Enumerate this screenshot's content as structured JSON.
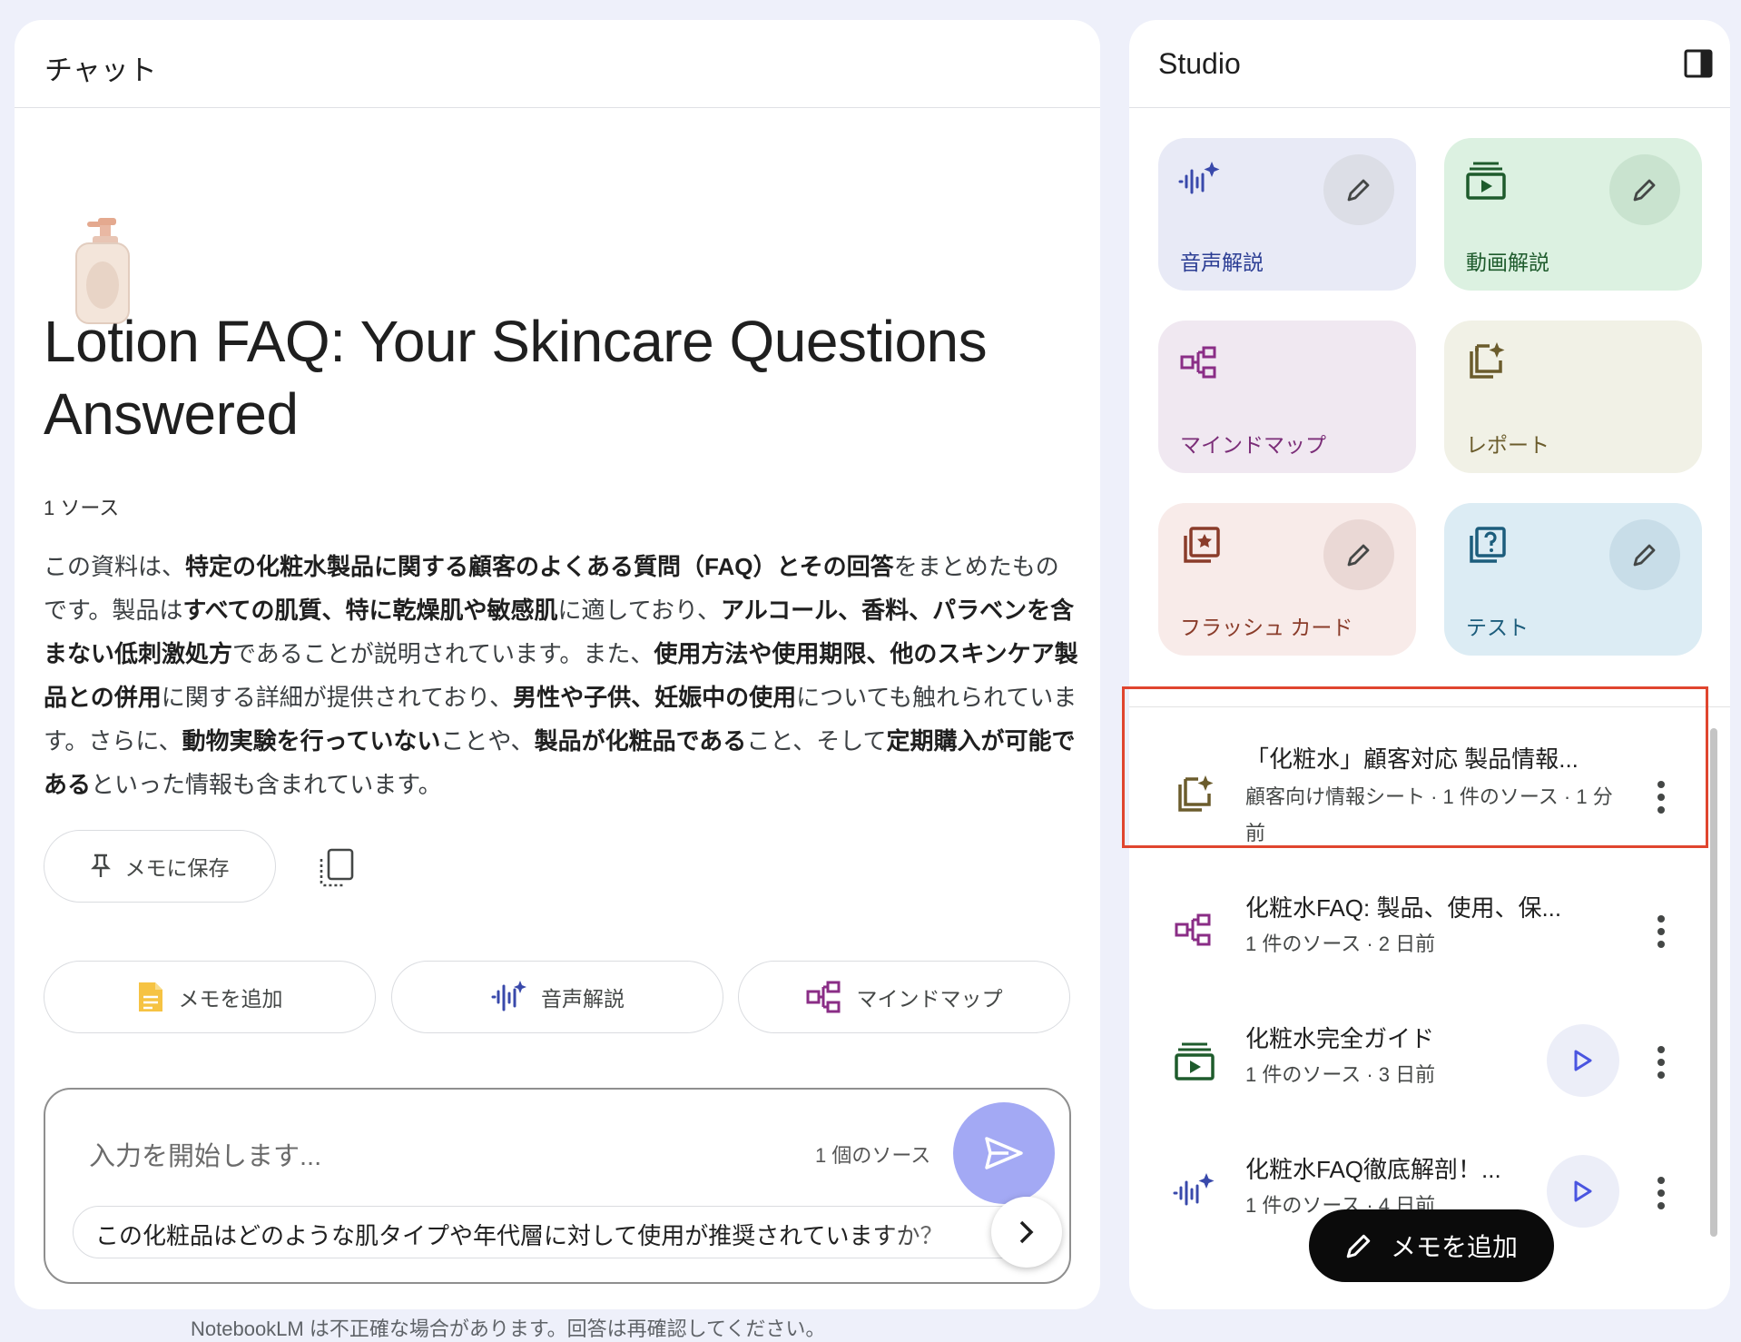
{
  "chat": {
    "title": "チャット",
    "doc_title": "Lotion FAQ: Your Skincare Questions Answered",
    "emoji_icon": "lotion-bottle-icon",
    "source_count": "1 ソース",
    "summary": [
      {
        "t": "この資料は、",
        "b": false
      },
      {
        "t": "特定の化粧水製品に関する顧客のよくある質問（FAQ）とその回答",
        "b": true
      },
      {
        "t": "をまとめたものです。製品は",
        "b": false
      },
      {
        "t": "すべての肌質、特に乾燥肌や敏感肌",
        "b": true
      },
      {
        "t": "に適しており、",
        "b": false
      },
      {
        "t": "アルコール、香料、パラベンを含まない低刺激処方",
        "b": true
      },
      {
        "t": "であることが説明されています。また、",
        "b": false
      },
      {
        "t": "使用方法や使用期限、他のスキンケア製品との併用",
        "b": true
      },
      {
        "t": "に関する詳細が提供されており、",
        "b": false
      },
      {
        "t": "男性や子供、妊娠中の使用",
        "b": true
      },
      {
        "t": "についても触れられています。さらに、",
        "b": false
      },
      {
        "t": "動物実験を行っていない",
        "b": true
      },
      {
        "t": "ことや、",
        "b": false
      },
      {
        "t": "製品が化粧品である",
        "b": true
      },
      {
        "t": "こと、そして",
        "b": false
      },
      {
        "t": "定期購入が可能である",
        "b": true
      },
      {
        "t": "といった情報も含まれています。",
        "b": false
      }
    ],
    "save_note_label": "メモに保存",
    "actions": {
      "memo": "メモを追加",
      "audio": "音声解説",
      "mindmap": "マインドマップ"
    },
    "input": {
      "placeholder": "入力を開始します...",
      "source_count": "1 個のソース"
    },
    "suggestion": "この化粧品はどのような肌タイプや年代層に対して使用が推奨されていますか？",
    "disclaimer": "NotebookLM は不正確な場合があります。回答は再確認してください。"
  },
  "studio": {
    "title": "Studio",
    "tiles": {
      "audio": "音声解説",
      "video": "動画解説",
      "mindmap": "マインドマップ",
      "report": "レポート",
      "flashcards": "フラッシュ カード",
      "quiz": "テスト"
    },
    "notes": [
      {
        "title": "「化粧水」顧客対応 製品情報...",
        "meta": "顧客向け情報シート · 1 件のソース · 1 分前",
        "icon": "report-icon"
      },
      {
        "title": "化粧水FAQ: 製品、使用、保...",
        "meta": "1 件のソース · 2 日前",
        "icon": "mindmap-icon"
      },
      {
        "title": "化粧水完全ガイド",
        "meta": "1 件のソース · 3 日前",
        "icon": "video-icon"
      },
      {
        "title": "化粧水FAQ徹底解剖！...",
        "meta": "1 件のソース · 4 日前",
        "icon": "audio-icon"
      }
    ],
    "add_note_label": "メモを追加"
  },
  "colors": {
    "background": "#eef0fa",
    "send_button": "#a3a9f4",
    "highlight": "#e0452e",
    "audio": "#3949ab",
    "video": "#1e5b2c",
    "mindmap": "#8a2d86",
    "report": "#6b5c2c",
    "flashcards": "#8a3c2a",
    "quiz": "#1c5d7c"
  }
}
